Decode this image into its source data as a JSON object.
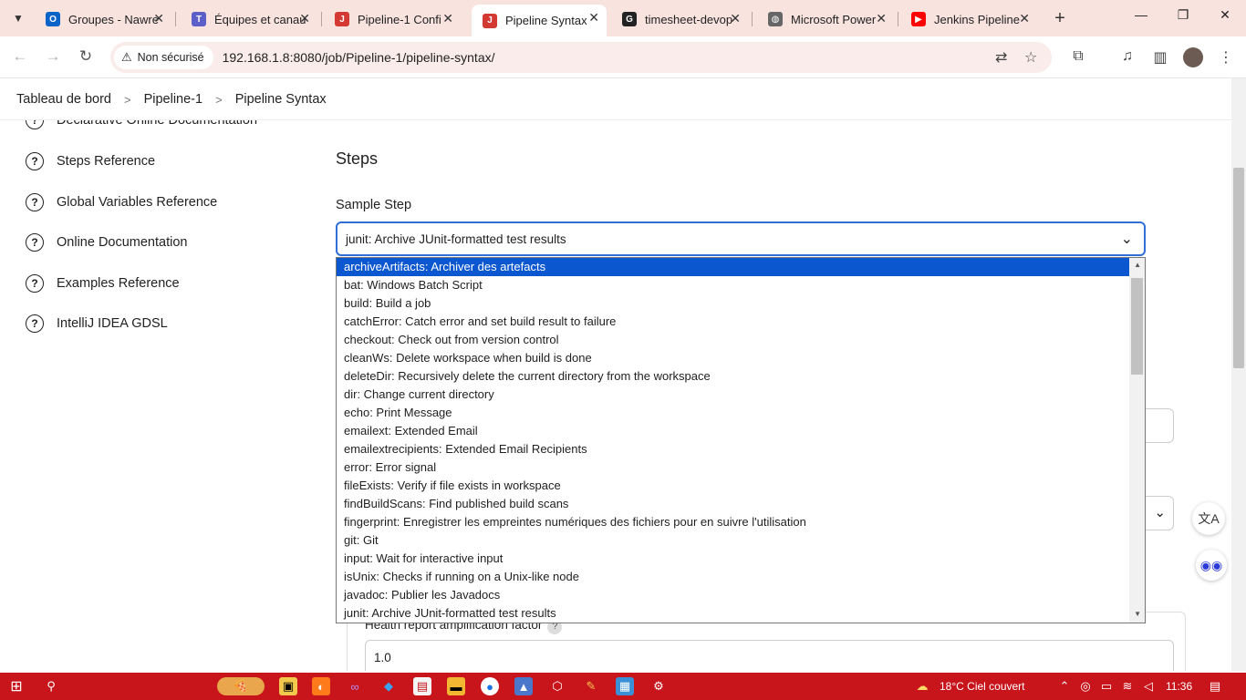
{
  "browser": {
    "tabs": [
      {
        "title": "Groupes - Nawre",
        "icon": "outlook-icon",
        "color": "#0a64c8",
        "glyph": "O"
      },
      {
        "title": "Équipes et canau",
        "icon": "teams-icon",
        "color": "#5b5fc7",
        "glyph": "T"
      },
      {
        "title": "Pipeline-1 Confi",
        "icon": "jenkins-icon",
        "color": "#d33833",
        "glyph": "J"
      },
      {
        "title": "Pipeline Syntax",
        "icon": "jenkins-icon",
        "color": "#d33833",
        "glyph": "J"
      },
      {
        "title": "timesheet-devop",
        "icon": "github-icon",
        "color": "#222222",
        "glyph": "G"
      },
      {
        "title": "Microsoft Power",
        "icon": "globe-icon",
        "color": "#666666",
        "glyph": "◍"
      },
      {
        "title": "Jenkins Pipeline",
        "icon": "youtube-icon",
        "color": "#ff0000",
        "glyph": "▶"
      }
    ],
    "security_label": "Non sécurisé",
    "url": "192.168.1.8:8080/job/Pipeline-1/pipeline-syntax/"
  },
  "breadcrumb": {
    "items": [
      "Tableau de bord",
      "Pipeline-1",
      "Pipeline Syntax"
    ],
    "separator": ">"
  },
  "sidebar": {
    "items": [
      {
        "label": "Declarative Online Documentation"
      },
      {
        "label": "Steps Reference"
      },
      {
        "label": "Global Variables Reference"
      },
      {
        "label": "Online Documentation"
      },
      {
        "label": "Examples Reference"
      },
      {
        "label": "IntelliJ IDEA GDSL"
      }
    ],
    "help_glyph": "?"
  },
  "main": {
    "section_title": "Steps",
    "sample_step_label": "Sample Step",
    "selected_step": "junit: Archive JUnit-formatted test results",
    "hidden_field_label": "Health report amplification factor",
    "hidden_field_value": "1.0",
    "steps_options": [
      "archiveArtifacts: Archiver des artefacts",
      "bat: Windows Batch Script",
      "build: Build a job",
      "catchError: Catch error and set build result to failure",
      "checkout: Check out from version control",
      "cleanWs: Delete workspace when build is done",
      "deleteDir: Recursively delete the current directory from the workspace",
      "dir: Change current directory",
      "echo: Print Message",
      "emailext: Extended Email",
      "emailextrecipients: Extended Email Recipients",
      "error: Error signal",
      "fileExists: Verify if file exists in workspace",
      "findBuildScans: Find published build scans",
      "fingerprint: Enregistrer les empreintes numériques des fichiers pour en suivre l'utilisation",
      "git: Git",
      "input: Wait for interactive input",
      "isUnix: Checks if running on a Unix-like node",
      "javadoc: Publier les Javadocs",
      "junit: Archive JUnit-formatted test results"
    ]
  },
  "taskbar": {
    "weather": "18°C  Ciel couvert",
    "time": "11:36"
  },
  "colors": {
    "tabstrip": "#f8e3de",
    "accent": "#2f6fd6",
    "selection": "#0b57d0",
    "taskbar": "#c8141b"
  }
}
